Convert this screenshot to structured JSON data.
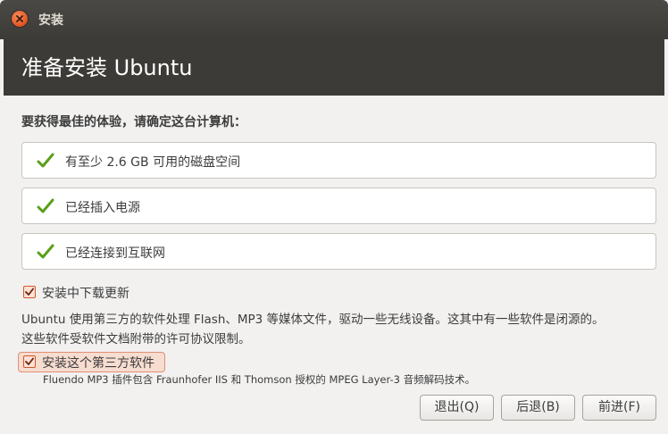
{
  "window": {
    "title": "安装"
  },
  "header": {
    "title": "准备安装 Ubuntu"
  },
  "prompt": "要获得最佳的体验，请确定这台计算机：",
  "requirements": [
    {
      "label": "有至少 2.6 GB 可用的磁盘空间",
      "status": "checked"
    },
    {
      "label": "已经插入电源",
      "status": "checked"
    },
    {
      "label": "已经连接到互联网",
      "status": "checked"
    }
  ],
  "options": {
    "download_updates": {
      "label": "安装中下载更新",
      "checked": true
    },
    "third_party": {
      "label": "安装这个第三方软件",
      "checked": true
    }
  },
  "description_line1": "Ubuntu 使用第三方的软件处理 Flash、MP3 等媒体文件，驱动一些无线设备。这其中有一些软件是闭源的。",
  "description_line2": "这些软件受软件文档附带的许可协议限制。",
  "third_party_note": "Fluendo MP3 插件包含 Fraunhofer IIS 和 Thomson 授权的 MPEG Layer-3 音频解码技术。",
  "buttons": {
    "quit": "退出(Q)",
    "back": "后退(B)",
    "forward": "前进(F)"
  },
  "colors": {
    "accent": "#dd4814",
    "check_green": "#5a9f1b",
    "header_bg": "#3c3b37"
  }
}
